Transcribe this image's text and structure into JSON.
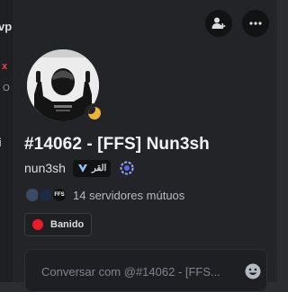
{
  "background_fragments": {
    "top_text": "vp",
    "red_mark": "x",
    "small_text": "O",
    "mid_text": "i"
  },
  "profile": {
    "display_name": "#14062 - [FFS] Nun3sh",
    "username": "nun3sh",
    "clan_tag": "القر",
    "status": "idle",
    "mutual_servers_text": "14 servidores mútuos",
    "mutual_server_icons": [
      "server-icon-1",
      "server-icon-2",
      "server-icon-3"
    ],
    "mutual_server_labels": [
      "",
      "",
      "FFS"
    ],
    "role_badge": "Banido",
    "role_color": "#ed1c24"
  },
  "actions": {
    "add_friend_icon": "add-friend-icon",
    "more_icon": "more-icon"
  },
  "message": {
    "placeholder": "Conversar com @#14062 - [FFS...",
    "emoji_icon": "emoji-icon"
  },
  "colors": {
    "panel_bg": "#232428",
    "idle": "#f0b232",
    "banned": "#ed1c24"
  }
}
